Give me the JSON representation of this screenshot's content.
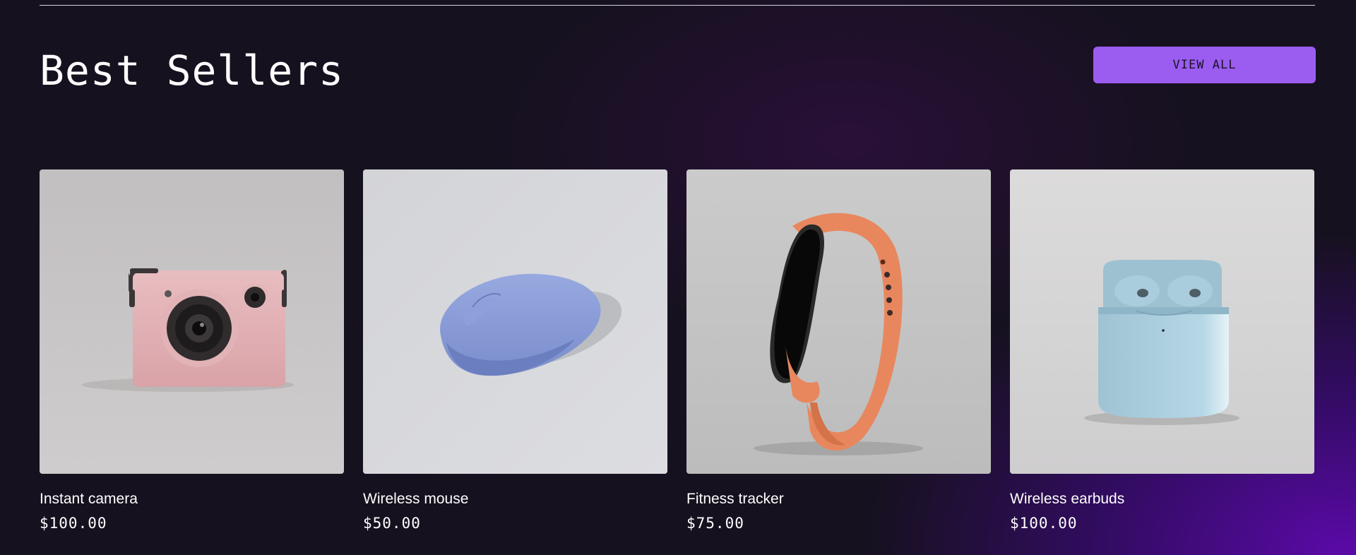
{
  "section": {
    "title": "Best Sellers",
    "view_all_label": "VIEW ALL"
  },
  "colors": {
    "accent": "#9b5cf0",
    "background": "#16111f"
  },
  "products": [
    {
      "name": "Instant camera",
      "price": "$100.00",
      "image": "pink-camera-image"
    },
    {
      "name": "Wireless mouse",
      "price": "$50.00",
      "image": "blue-mouse-image"
    },
    {
      "name": "Fitness tracker",
      "price": "$75.00",
      "image": "orange-fitness-band-image"
    },
    {
      "name": "Wireless earbuds",
      "price": "$100.00",
      "image": "light-blue-earbuds-case-image"
    }
  ]
}
